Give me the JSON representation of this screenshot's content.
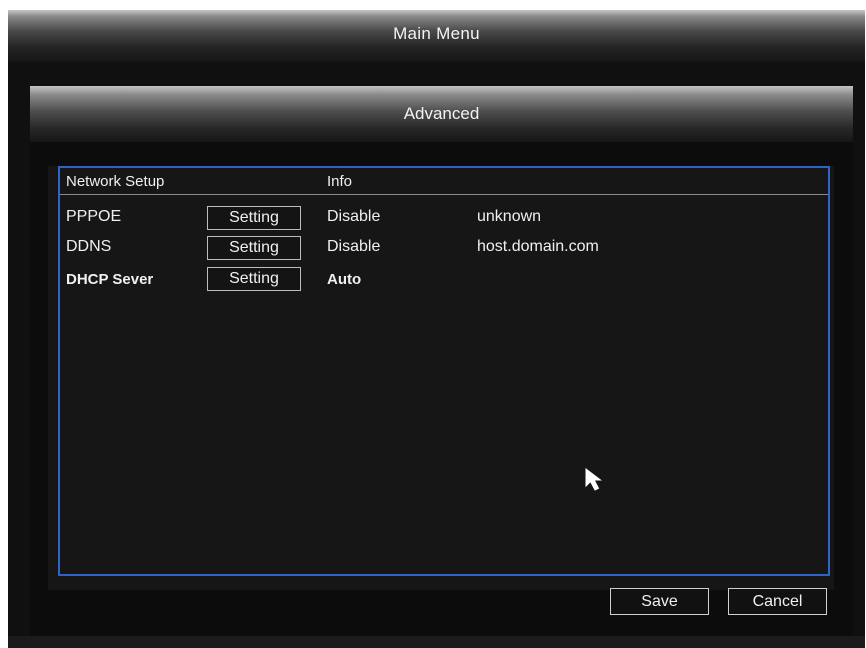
{
  "main_menu": {
    "title": "Main Menu"
  },
  "advanced": {
    "title": "Advanced",
    "headers": {
      "network_setup": "Network Setup",
      "info": "Info"
    },
    "rows": [
      {
        "name": "PPPOE",
        "button": "Setting",
        "status": "Disable",
        "info": "unknown"
      },
      {
        "name": "DDNS",
        "button": "Setting",
        "status": "Disable",
        "info": "host.domain.com"
      },
      {
        "name": "DHCP Sever",
        "button": "Setting",
        "status": "Auto",
        "info": ""
      }
    ],
    "save_label": "Save",
    "cancel_label": "Cancel"
  },
  "icons": {
    "cursor": "mouse-pointer-icon"
  },
  "colors": {
    "frame_border": "#2f63c8",
    "background": "#101010",
    "text": "#f0f0f0"
  }
}
